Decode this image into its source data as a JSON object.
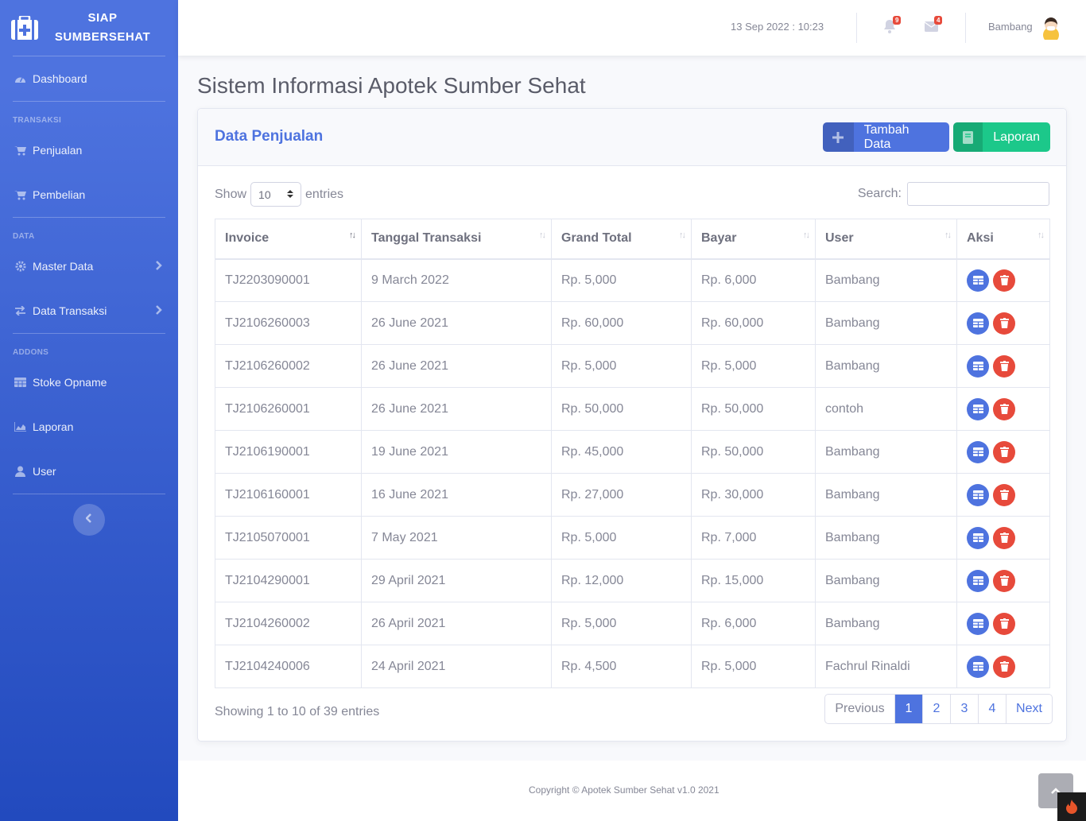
{
  "brand": {
    "line1": "SIAP",
    "line2": "SUMBERSEHAT"
  },
  "sidebar": {
    "dashboard": "Dashboard",
    "heading_transaksi": "TRANSAKSI",
    "penjualan": "Penjualan",
    "pembelian": "Pembelian",
    "heading_data": "DATA",
    "master_data": "Master Data",
    "data_transaksi": "Data Transaksi",
    "heading_addons": "ADDONS",
    "stoke_opname": "Stoke Opname",
    "laporan": "Laporan",
    "user": "User"
  },
  "topbar": {
    "datetime": "13 Sep 2022 : 10:23",
    "alerts_count": "9",
    "messages_count": "4",
    "username": "Bambang"
  },
  "page": {
    "title": "Sistem Informasi Apotek Sumber Sehat"
  },
  "card": {
    "title": "Data Penjualan",
    "add_button": "Tambah Data",
    "report_button": "Laporan"
  },
  "table_controls": {
    "show_label": "Show",
    "entries_value": "10",
    "entries_label": "entries",
    "search_label": "Search:"
  },
  "table": {
    "headers": [
      "Invoice",
      "Tanggal Transaksi",
      "Grand Total",
      "Bayar",
      "User",
      "Aksi"
    ],
    "rows": [
      [
        "TJ2203090001",
        "9 March 2022",
        "Rp. 5,000",
        "Rp. 6,000",
        "Bambang"
      ],
      [
        "TJ2106260003",
        "26 June 2021",
        "Rp. 60,000",
        "Rp. 60,000",
        "Bambang"
      ],
      [
        "TJ2106260002",
        "26 June 2021",
        "Rp. 5,000",
        "Rp. 5,000",
        "Bambang"
      ],
      [
        "TJ2106260001",
        "26 June 2021",
        "Rp. 50,000",
        "Rp. 50,000",
        "contoh"
      ],
      [
        "TJ2106190001",
        "19 June 2021",
        "Rp. 45,000",
        "Rp. 50,000",
        "Bambang"
      ],
      [
        "TJ2106160001",
        "16 June 2021",
        "Rp. 27,000",
        "Rp. 30,000",
        "Bambang"
      ],
      [
        "TJ2105070001",
        "7 May 2021",
        "Rp. 5,000",
        "Rp. 7,000",
        "Bambang"
      ],
      [
        "TJ2104290001",
        "29 April 2021",
        "Rp. 12,000",
        "Rp. 15,000",
        "Bambang"
      ],
      [
        "TJ2104260002",
        "26 April 2021",
        "Rp. 5,000",
        "Rp. 6,000",
        "Bambang"
      ],
      [
        "TJ2104240006",
        "24 April 2021",
        "Rp. 4,500",
        "Rp. 5,000",
        "Fachrul Rinaldi"
      ]
    ]
  },
  "pagination": {
    "info": "Showing 1 to 10 of 39 entries",
    "previous": "Previous",
    "pages": [
      "1",
      "2",
      "3",
      "4"
    ],
    "next": "Next",
    "current_page": "1"
  },
  "footer": {
    "copyright": "Copyright © Apotek Sumber Sehat v1.0 2021"
  },
  "colors": {
    "primary": "#4e73df",
    "success": "#1cc88a",
    "danger": "#e74a3b"
  }
}
